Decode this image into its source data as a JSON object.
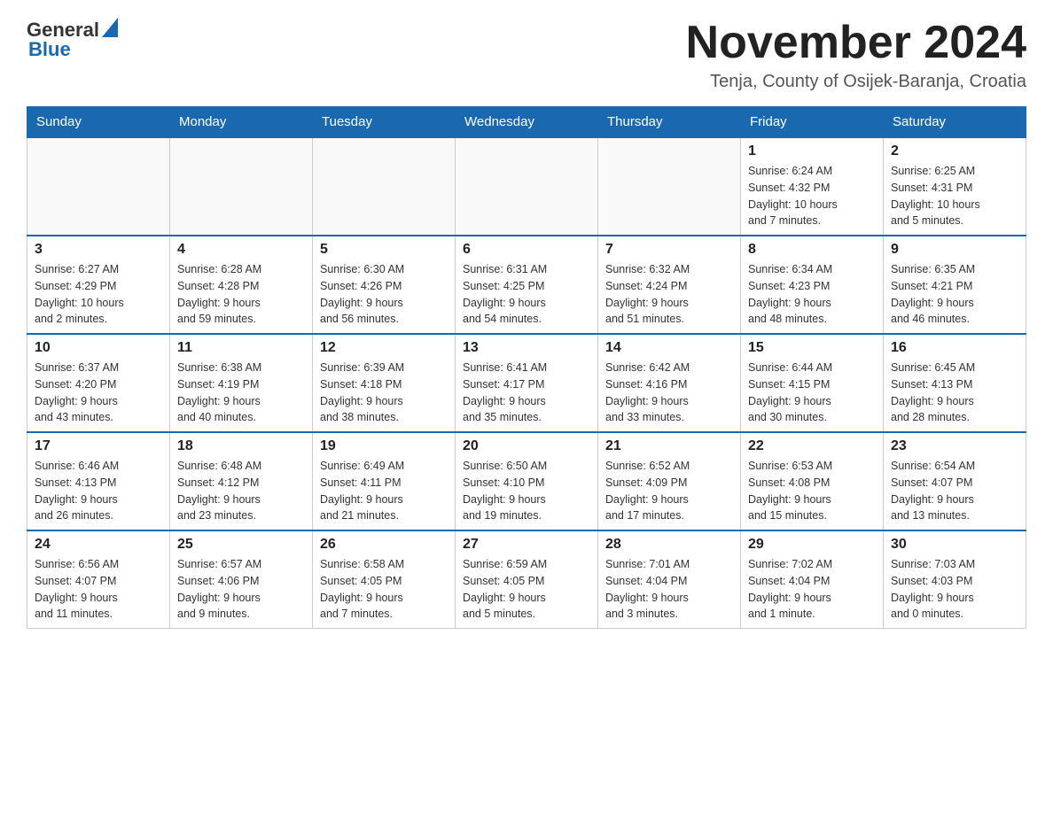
{
  "header": {
    "logo_general": "General",
    "logo_blue": "Blue",
    "title": "November 2024",
    "location": "Tenja, County of Osijek-Baranja, Croatia"
  },
  "weekdays": [
    "Sunday",
    "Monday",
    "Tuesday",
    "Wednesday",
    "Thursday",
    "Friday",
    "Saturday"
  ],
  "weeks": [
    [
      {
        "day": "",
        "info": ""
      },
      {
        "day": "",
        "info": ""
      },
      {
        "day": "",
        "info": ""
      },
      {
        "day": "",
        "info": ""
      },
      {
        "day": "",
        "info": ""
      },
      {
        "day": "1",
        "info": "Sunrise: 6:24 AM\nSunset: 4:32 PM\nDaylight: 10 hours\nand 7 minutes."
      },
      {
        "day": "2",
        "info": "Sunrise: 6:25 AM\nSunset: 4:31 PM\nDaylight: 10 hours\nand 5 minutes."
      }
    ],
    [
      {
        "day": "3",
        "info": "Sunrise: 6:27 AM\nSunset: 4:29 PM\nDaylight: 10 hours\nand 2 minutes."
      },
      {
        "day": "4",
        "info": "Sunrise: 6:28 AM\nSunset: 4:28 PM\nDaylight: 9 hours\nand 59 minutes."
      },
      {
        "day": "5",
        "info": "Sunrise: 6:30 AM\nSunset: 4:26 PM\nDaylight: 9 hours\nand 56 minutes."
      },
      {
        "day": "6",
        "info": "Sunrise: 6:31 AM\nSunset: 4:25 PM\nDaylight: 9 hours\nand 54 minutes."
      },
      {
        "day": "7",
        "info": "Sunrise: 6:32 AM\nSunset: 4:24 PM\nDaylight: 9 hours\nand 51 minutes."
      },
      {
        "day": "8",
        "info": "Sunrise: 6:34 AM\nSunset: 4:23 PM\nDaylight: 9 hours\nand 48 minutes."
      },
      {
        "day": "9",
        "info": "Sunrise: 6:35 AM\nSunset: 4:21 PM\nDaylight: 9 hours\nand 46 minutes."
      }
    ],
    [
      {
        "day": "10",
        "info": "Sunrise: 6:37 AM\nSunset: 4:20 PM\nDaylight: 9 hours\nand 43 minutes."
      },
      {
        "day": "11",
        "info": "Sunrise: 6:38 AM\nSunset: 4:19 PM\nDaylight: 9 hours\nand 40 minutes."
      },
      {
        "day": "12",
        "info": "Sunrise: 6:39 AM\nSunset: 4:18 PM\nDaylight: 9 hours\nand 38 minutes."
      },
      {
        "day": "13",
        "info": "Sunrise: 6:41 AM\nSunset: 4:17 PM\nDaylight: 9 hours\nand 35 minutes."
      },
      {
        "day": "14",
        "info": "Sunrise: 6:42 AM\nSunset: 4:16 PM\nDaylight: 9 hours\nand 33 minutes."
      },
      {
        "day": "15",
        "info": "Sunrise: 6:44 AM\nSunset: 4:15 PM\nDaylight: 9 hours\nand 30 minutes."
      },
      {
        "day": "16",
        "info": "Sunrise: 6:45 AM\nSunset: 4:13 PM\nDaylight: 9 hours\nand 28 minutes."
      }
    ],
    [
      {
        "day": "17",
        "info": "Sunrise: 6:46 AM\nSunset: 4:13 PM\nDaylight: 9 hours\nand 26 minutes."
      },
      {
        "day": "18",
        "info": "Sunrise: 6:48 AM\nSunset: 4:12 PM\nDaylight: 9 hours\nand 23 minutes."
      },
      {
        "day": "19",
        "info": "Sunrise: 6:49 AM\nSunset: 4:11 PM\nDaylight: 9 hours\nand 21 minutes."
      },
      {
        "day": "20",
        "info": "Sunrise: 6:50 AM\nSunset: 4:10 PM\nDaylight: 9 hours\nand 19 minutes."
      },
      {
        "day": "21",
        "info": "Sunrise: 6:52 AM\nSunset: 4:09 PM\nDaylight: 9 hours\nand 17 minutes."
      },
      {
        "day": "22",
        "info": "Sunrise: 6:53 AM\nSunset: 4:08 PM\nDaylight: 9 hours\nand 15 minutes."
      },
      {
        "day": "23",
        "info": "Sunrise: 6:54 AM\nSunset: 4:07 PM\nDaylight: 9 hours\nand 13 minutes."
      }
    ],
    [
      {
        "day": "24",
        "info": "Sunrise: 6:56 AM\nSunset: 4:07 PM\nDaylight: 9 hours\nand 11 minutes."
      },
      {
        "day": "25",
        "info": "Sunrise: 6:57 AM\nSunset: 4:06 PM\nDaylight: 9 hours\nand 9 minutes."
      },
      {
        "day": "26",
        "info": "Sunrise: 6:58 AM\nSunset: 4:05 PM\nDaylight: 9 hours\nand 7 minutes."
      },
      {
        "day": "27",
        "info": "Sunrise: 6:59 AM\nSunset: 4:05 PM\nDaylight: 9 hours\nand 5 minutes."
      },
      {
        "day": "28",
        "info": "Sunrise: 7:01 AM\nSunset: 4:04 PM\nDaylight: 9 hours\nand 3 minutes."
      },
      {
        "day": "29",
        "info": "Sunrise: 7:02 AM\nSunset: 4:04 PM\nDaylight: 9 hours\nand 1 minute."
      },
      {
        "day": "30",
        "info": "Sunrise: 7:03 AM\nSunset: 4:03 PM\nDaylight: 9 hours\nand 0 minutes."
      }
    ]
  ]
}
